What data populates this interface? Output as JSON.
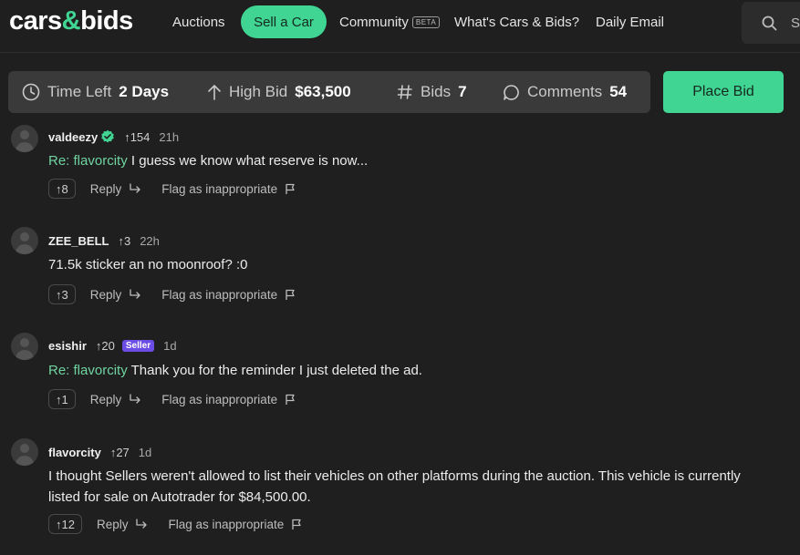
{
  "header": {
    "logo_left": "cars",
    "logo_amp": "&",
    "logo_right": "bids",
    "nav": {
      "auctions": "Auctions",
      "sell": "Sell a Car",
      "community": "Community",
      "community_badge": "BETA",
      "whats": "What's Cars & Bids?",
      "daily": "Daily Email"
    },
    "search_partial": "S"
  },
  "stats": {
    "time_left_label": "Time Left",
    "time_left_value": "2 Days",
    "high_bid_label": "High Bid",
    "high_bid_value": "$63,500",
    "bids_label": "Bids",
    "bids_value": "7",
    "comments_label": "Comments",
    "comments_value": "54",
    "place_bid": "Place Bid"
  },
  "comments": [
    {
      "user": "valdeezy",
      "rep": "↑154",
      "time": "21h",
      "reply_to": "Re: flavorcity",
      "text": " I guess we know what reserve is now...",
      "upvotes": "↑8",
      "reply_label": "Reply",
      "flag_label": "Flag as inappropriate"
    },
    {
      "user": "ZEE_BELL",
      "rep": "↑3",
      "time": "22h",
      "text": "71.5k sticker an no moonroof? :0",
      "upvotes": "↑3",
      "reply_label": "Reply",
      "flag_label": "Flag as inappropriate"
    },
    {
      "user": "esishir",
      "rep": "↑20",
      "badge": "Seller",
      "time": "1d",
      "reply_to": "Re: flavorcity",
      "text": " Thank you for the reminder I just deleted the ad.",
      "upvotes": "↑1",
      "reply_label": "Reply",
      "flag_label": "Flag as inappropriate"
    },
    {
      "user": "flavorcity",
      "rep": "↑27",
      "time": "1d",
      "text": "I thought Sellers weren't allowed to list their vehicles on other platforms during the auction. This vehicle is currently listed for sale on Autotrader for $84,500.00.",
      "upvotes": "↑12",
      "reply_label": "Reply",
      "flag_label": "Flag as inappropriate"
    }
  ],
  "colors": {
    "accent": "#40d593",
    "background": "#1f1f1f",
    "stats_bar": "#3a3a3a",
    "seller_badge": "#6b4de6"
  }
}
